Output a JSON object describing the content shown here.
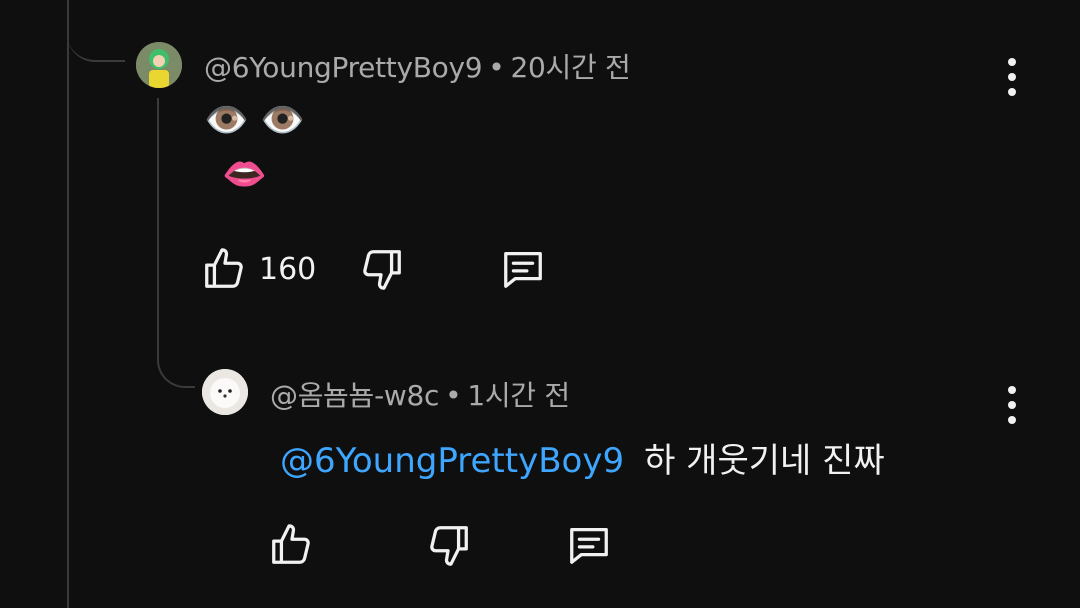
{
  "comment": {
    "author": "@6YoungPrettyBoy9",
    "separator": "•",
    "time": "20시간 전",
    "emoji_line1": "👁️ 👁️",
    "emoji_line2": "👄",
    "likes": "160"
  },
  "reply": {
    "author": "@옴뇸뇸-w8c",
    "separator": "•",
    "time": "1시간 전",
    "mention": "@6YoungPrettyBoy9",
    "text": "하 개웃기네 진짜"
  },
  "icons": {
    "like": "thumb-up-icon",
    "dislike": "thumb-down-icon",
    "reply": "comment-icon",
    "menu": "more-vertical-icon"
  },
  "colors": {
    "background": "#0f0f0f",
    "mention": "#3ea6ff",
    "meta": "#aaaaaa"
  }
}
